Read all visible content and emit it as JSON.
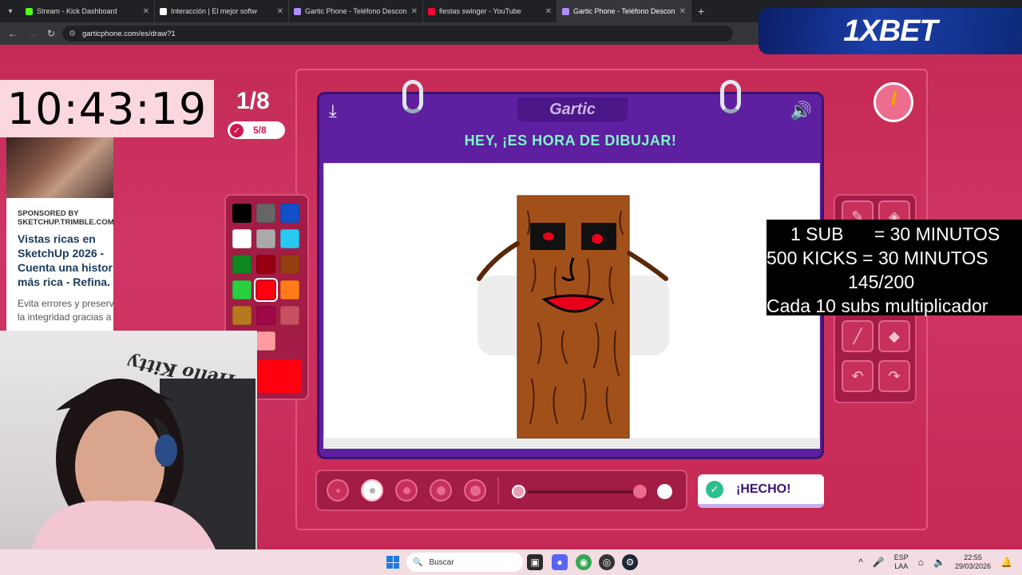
{
  "browser": {
    "tabs": [
      {
        "title": "Stream - Kick Dashboard",
        "color": "#53fc18"
      },
      {
        "title": "Interacción | El mejor softw",
        "color": "#ffffff"
      },
      {
        "title": "Gartic Phone - Teléfono Descon",
        "color": "#b08cff"
      },
      {
        "title": "fiestas swinger - YouTube",
        "color": "#ff0033"
      },
      {
        "title": "Gartic Phone - Teléfono Descon",
        "color": "#b08cff",
        "active": true
      }
    ],
    "url": "garticphone.com/es/draw?1"
  },
  "game": {
    "round": "1/8",
    "players_done": "5/8",
    "logo": "Gartic",
    "prompt": "HEY, ¡ES HORA DE DIBUJAR!",
    "done_button": "¡HECHO!",
    "palette": [
      "#000000",
      "#666666",
      "#1050c8",
      "#ffffff",
      "#aaaaaa",
      "#28c8f0",
      "#108820",
      "#960010",
      "#964010",
      "#28d040",
      "#ff0011",
      "#ff7c18",
      "#b87820",
      "#a00848",
      "#c85060",
      "#ff2088",
      "#ff9ca0"
    ],
    "selected_color": "#ff0011",
    "brush_sizes": [
      1,
      2,
      3,
      4,
      5
    ],
    "selected_brush_size": 2,
    "tools": [
      "pencil-icon",
      "bucket-icon",
      "line-icon",
      "fill-icon",
      "undo-icon",
      "redo-icon"
    ]
  },
  "overlays": {
    "clock": "10:43:19",
    "ad": {
      "sponsor": [
        "SPONSORED BY",
        "SKETCHUP.TRIMBLE.COM"
      ],
      "headline": [
        "Vistas ricas en",
        "SketchUp 2026 -",
        "Cuenta una histor",
        "más rica - Refina."
      ],
      "body": [
        "Evita errores y preserv",
        "la integridad gracias a"
      ]
    },
    "banner": "1XBET",
    "webcam_sign": "Hello Kitty",
    "info_lines": [
      "1 SUB      = 30 MINUTOS",
      "500 KICKS = 30 MINUTOS",
      "145/200",
      "Cada 10 subs multiplicador"
    ]
  },
  "taskbar": {
    "search_placeholder": "Buscar",
    "lang": [
      "ESP",
      "LAA"
    ],
    "time": "22:55",
    "date": "29/03/2026"
  }
}
